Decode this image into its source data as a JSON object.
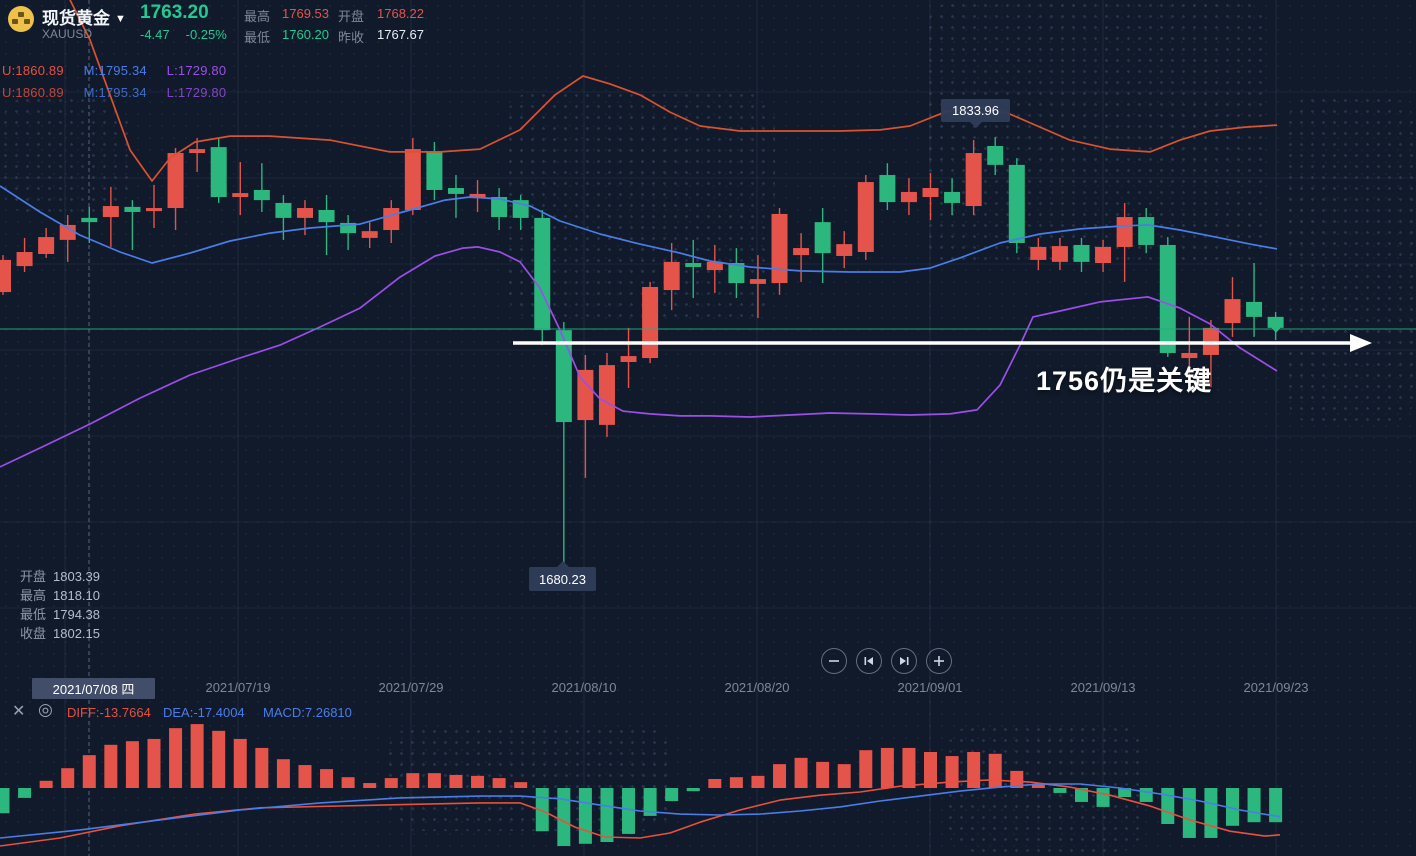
{
  "header": {
    "instrument": "现货黄金",
    "symbol": "XAUUSD",
    "price": "1763.20",
    "change": "-4.47",
    "change_pct": "-0.25%",
    "stats": [
      {
        "label": "最高",
        "value": "1769.53",
        "color": "red"
      },
      {
        "label": "开盘",
        "value": "1768.22",
        "color": "red"
      },
      {
        "label": "最低",
        "value": "1760.20",
        "color": "green"
      },
      {
        "label": "昨收",
        "value": "1767.67",
        "color": "white"
      }
    ]
  },
  "boll_rows": [
    {
      "u": "U:1860.89",
      "m": "M:1795.34",
      "l": "L:1729.80"
    },
    {
      "u": "U:1860.89",
      "m": "M:1795.34",
      "l": "L:1729.80"
    }
  ],
  "ohlc_panel": {
    "rows": [
      {
        "label": "开盘",
        "value": "1803.39"
      },
      {
        "label": "最高",
        "value": "1818.10"
      },
      {
        "label": "最低",
        "value": "1794.38"
      },
      {
        "label": "收盘",
        "value": "1802.15"
      }
    ]
  },
  "annotations": {
    "peak_label": "1833.96",
    "low_label": "1680.23",
    "key_level_text": "1756仍是关键"
  },
  "x_axis": {
    "highlighted": "2021/07/08 四",
    "ticks": [
      "2021/07/19",
      "2021/07/29",
      "2021/08/10",
      "2021/08/20",
      "2021/09/01",
      "2021/09/13",
      "2021/09/23"
    ]
  },
  "macd_bar": {
    "diff": "DIFF:-13.7664",
    "dea": "DEA:-17.4004",
    "macd": "MACD:7.26810"
  },
  "controls": [
    {
      "name": "zoom-out",
      "glyph": "minus"
    },
    {
      "name": "skip-to-start",
      "glyph": "bar-left-triangle"
    },
    {
      "name": "skip-to-end",
      "glyph": "triangle-bar-right"
    },
    {
      "name": "zoom-in",
      "glyph": "plus"
    }
  ],
  "colors": {
    "red": "#e4544b",
    "green": "#1fcb90",
    "white": "#e8edf5",
    "up": "#e4544b",
    "down": "#2bb77e",
    "band_upper": "#d9532f",
    "band_mid": "#4a7de8",
    "band_lower": "#9b4fe8",
    "dif": "#e8503f",
    "dea": "#4a7de8",
    "price_line": "#2aa87c",
    "accent_gold": "#eec24a"
  },
  "chart_data": {
    "type": "candlestick+macd",
    "symbol": "XAUUSD",
    "current_price": 1763.2,
    "legend": [
      "BOLL(upper)",
      "BOLL(mid)",
      "BOLL(lower)",
      "DIF",
      "DEA",
      "MACD"
    ],
    "candles": [
      [
        1776.3,
        1789.4,
        1775.3,
        1787.7
      ],
      [
        1785.5,
        1795.5,
        1783.4,
        1790.5
      ],
      [
        1789.8,
        1799.0,
        1788.4,
        1795.8
      ],
      [
        1794.8,
        1803.6,
        1787.0,
        1800.1
      ],
      [
        1802.6,
        1806.5,
        1793.7,
        1801.1
      ],
      [
        1802.9,
        1813.6,
        1792.3,
        1806.8
      ],
      [
        1806.5,
        1808.9,
        1791.2,
        1804.7
      ],
      [
        1805.0,
        1814.3,
        1799.0,
        1806.1
      ],
      [
        1806.1,
        1827.4,
        1798.3,
        1825.6
      ],
      [
        1825.6,
        1830.9,
        1818.9,
        1827.0
      ],
      [
        1827.7,
        1830.9,
        1807.9,
        1810.0
      ],
      [
        1810.0,
        1822.4,
        1803.6,
        1811.4
      ],
      [
        1812.5,
        1822.0,
        1804.7,
        1808.9
      ],
      [
        1807.9,
        1810.7,
        1794.8,
        1802.6
      ],
      [
        1802.6,
        1808.9,
        1796.5,
        1806.1
      ],
      [
        1805.4,
        1810.7,
        1789.4,
        1801.1
      ],
      [
        1800.8,
        1803.6,
        1791.2,
        1797.2
      ],
      [
        1795.5,
        1801.1,
        1791.9,
        1797.9
      ],
      [
        1798.3,
        1808.9,
        1793.7,
        1806.1
      ],
      [
        1805.4,
        1830.9,
        1803.6,
        1827.0
      ],
      [
        1826.0,
        1829.5,
        1808.9,
        1812.5
      ],
      [
        1813.2,
        1817.8,
        1802.6,
        1811.1
      ],
      [
        1809.6,
        1816.0,
        1804.7,
        1811.1
      ],
      [
        1810.0,
        1813.2,
        1798.3,
        1802.9
      ],
      [
        1808.9,
        1810.7,
        1798.3,
        1802.6
      ],
      [
        1802.6,
        1805.4,
        1757.5,
        1762.8
      ],
      [
        1762.8,
        1765.7,
        1680.2,
        1730.2
      ],
      [
        1730.9,
        1754.0,
        1710.4,
        1748.7
      ],
      [
        1729.2,
        1754.7,
        1724.9,
        1750.4
      ],
      [
        1751.5,
        1763.6,
        1742.3,
        1753.6
      ],
      [
        1752.9,
        1779.9,
        1751.1,
        1778.1
      ],
      [
        1777.0,
        1793.7,
        1769.9,
        1787.0
      ],
      [
        1786.6,
        1794.8,
        1774.2,
        1785.2
      ],
      [
        1784.1,
        1793.0,
        1776.0,
        1787.0
      ],
      [
        1786.6,
        1791.9,
        1774.2,
        1779.5
      ],
      [
        1779.2,
        1789.4,
        1767.1,
        1780.9
      ],
      [
        1779.5,
        1806.1,
        1775.3,
        1804.0
      ],
      [
        1789.4,
        1797.2,
        1779.9,
        1791.9
      ],
      [
        1801.1,
        1806.1,
        1779.5,
        1790.1
      ],
      [
        1789.1,
        1797.9,
        1784.8,
        1793.3
      ],
      [
        1790.5,
        1817.8,
        1787.7,
        1815.3
      ],
      [
        1817.8,
        1822.0,
        1805.4,
        1808.2
      ],
      [
        1808.2,
        1816.7,
        1803.6,
        1811.8
      ],
      [
        1810.0,
        1818.5,
        1801.8,
        1813.2
      ],
      [
        1811.8,
        1816.7,
        1803.6,
        1807.9
      ],
      [
        1806.8,
        1830.2,
        1803.6,
        1825.6
      ],
      [
        1828.1,
        1831.3,
        1817.8,
        1821.4
      ],
      [
        1821.4,
        1823.8,
        1790.1,
        1793.7
      ],
      [
        1787.7,
        1795.5,
        1784.1,
        1792.3
      ],
      [
        1787.0,
        1795.5,
        1784.1,
        1792.6
      ],
      [
        1793.0,
        1795.5,
        1783.4,
        1787.0
      ],
      [
        1786.6,
        1794.8,
        1783.4,
        1792.3
      ],
      [
        1792.3,
        1807.9,
        1779.9,
        1802.9
      ],
      [
        1802.9,
        1806.1,
        1790.1,
        1793.0
      ],
      [
        1793.0,
        1795.8,
        1753.3,
        1754.7
      ],
      [
        1752.9,
        1767.5,
        1742.6,
        1754.7
      ],
      [
        1754.0,
        1766.4,
        1742.6,
        1763.6
      ],
      [
        1765.3,
        1781.6,
        1760.4,
        1773.8
      ],
      [
        1772.8,
        1786.6,
        1760.4,
        1767.5
      ],
      [
        1767.5,
        1769.2,
        1759.3,
        1763.6
      ]
    ],
    "boll_upper": [
      [
        70,
        1879.9
      ],
      [
        90,
        1865.7
      ],
      [
        110,
        1846.2
      ],
      [
        130,
        1826.7
      ],
      [
        152,
        1815.7
      ],
      [
        170,
        1823.8
      ],
      [
        195,
        1829.5
      ],
      [
        230,
        1831.6
      ],
      [
        270,
        1831.6
      ],
      [
        330,
        1830.2
      ],
      [
        390,
        1826.0
      ],
      [
        440,
        1826.0
      ],
      [
        480,
        1827.0
      ],
      [
        520,
        1833.8
      ],
      [
        555,
        1846.2
      ],
      [
        583,
        1852.9
      ],
      [
        610,
        1850.1
      ],
      [
        640,
        1846.2
      ],
      [
        670,
        1840.1
      ],
      [
        700,
        1835.2
      ],
      [
        740,
        1833.4
      ],
      [
        790,
        1833.4
      ],
      [
        840,
        1833.4
      ],
      [
        880,
        1833.8
      ],
      [
        910,
        1835.2
      ],
      [
        945,
        1840.1
      ],
      [
        977,
        1842.3
      ],
      [
        1010,
        1839.4
      ],
      [
        1040,
        1834.8
      ],
      [
        1070,
        1830.2
      ],
      [
        1110,
        1827.0
      ],
      [
        1150,
        1826.0
      ],
      [
        1180,
        1830.2
      ],
      [
        1210,
        1833.4
      ],
      [
        1245,
        1834.8
      ],
      [
        1277,
        1835.5
      ]
    ],
    "boll_mid": [
      [
        0,
        1813.9
      ],
      [
        40,
        1804.7
      ],
      [
        80,
        1796.5
      ],
      [
        120,
        1790.5
      ],
      [
        152,
        1786.6
      ],
      [
        190,
        1790.1
      ],
      [
        230,
        1794.4
      ],
      [
        270,
        1797.2
      ],
      [
        310,
        1799.0
      ],
      [
        360,
        1800.4
      ],
      [
        410,
        1805.4
      ],
      [
        445,
        1808.9
      ],
      [
        470,
        1810.0
      ],
      [
        500,
        1809.3
      ],
      [
        530,
        1806.8
      ],
      [
        560,
        1801.5
      ],
      [
        600,
        1796.9
      ],
      [
        640,
        1793.3
      ],
      [
        680,
        1790.1
      ],
      [
        710,
        1787.3
      ],
      [
        750,
        1785.2
      ],
      [
        800,
        1783.8
      ],
      [
        850,
        1783.4
      ],
      [
        900,
        1783.4
      ],
      [
        930,
        1784.8
      ],
      [
        960,
        1788.4
      ],
      [
        1000,
        1793.7
      ],
      [
        1040,
        1796.9
      ],
      [
        1080,
        1798.7
      ],
      [
        1120,
        1799.7
      ],
      [
        1148,
        1800.1
      ],
      [
        1180,
        1798.3
      ],
      [
        1220,
        1795.5
      ],
      [
        1250,
        1793.3
      ],
      [
        1277,
        1791.6
      ]
    ],
    "boll_lower": [
      [
        0,
        1714.3
      ],
      [
        40,
        1721.0
      ],
      [
        90,
        1729.5
      ],
      [
        140,
        1738.7
      ],
      [
        190,
        1746.9
      ],
      [
        240,
        1752.9
      ],
      [
        280,
        1757.5
      ],
      [
        320,
        1763.9
      ],
      [
        360,
        1770.6
      ],
      [
        400,
        1781.6
      ],
      [
        435,
        1789.1
      ],
      [
        463,
        1791.9
      ],
      [
        478,
        1792.3
      ],
      [
        500,
        1790.5
      ],
      [
        520,
        1787.0
      ],
      [
        540,
        1777.7
      ],
      [
        560,
        1762.8
      ],
      [
        580,
        1746.2
      ],
      [
        600,
        1738.4
      ],
      [
        623,
        1734.1
      ],
      [
        650,
        1733.1
      ],
      [
        680,
        1732.4
      ],
      [
        710,
        1732.4
      ],
      [
        750,
        1732.0
      ],
      [
        790,
        1732.7
      ],
      [
        830,
        1733.4
      ],
      [
        870,
        1733.1
      ],
      [
        910,
        1732.7
      ],
      [
        950,
        1733.1
      ],
      [
        977,
        1734.5
      ],
      [
        1000,
        1743.3
      ],
      [
        1020,
        1757.5
      ],
      [
        1033,
        1767.5
      ],
      [
        1060,
        1769.6
      ],
      [
        1100,
        1772.8
      ],
      [
        1148,
        1774.6
      ],
      [
        1180,
        1770.6
      ],
      [
        1210,
        1765.0
      ],
      [
        1240,
        1756.5
      ],
      [
        1277,
        1748.3
      ]
    ],
    "macd_hist": [
      -5.6,
      -2.2,
      1.6,
      4.4,
      7.3,
      9.6,
      10.4,
      10.9,
      13.3,
      14.2,
      12.7,
      10.9,
      8.9,
      6.4,
      5.1,
      4.2,
      2.4,
      1.1,
      2.2,
      3.3,
      3.3,
      2.9,
      2.7,
      2.2,
      1.3,
      -9.6,
      -12.9,
      -12.4,
      -12.0,
      -10.2,
      -6.2,
      -2.9,
      -0.7,
      2.0,
      2.4,
      2.7,
      5.3,
      6.7,
      5.8,
      5.3,
      8.4,
      8.9,
      8.9,
      8.0,
      7.1,
      8.0,
      7.6,
      3.8,
      0.9,
      -1.1,
      -3.1,
      -4.2,
      -2.0,
      -3.1,
      -8.0,
      -11.1,
      -11.1,
      -8.4,
      -7.6,
      -7.6
    ],
    "dif_line": [
      [
        0,
        -12.9
      ],
      [
        60,
        -11.1
      ],
      [
        120,
        -8.4
      ],
      [
        195,
        -5.8
      ],
      [
        260,
        -4.4
      ],
      [
        340,
        -4.0
      ],
      [
        420,
        -3.6
      ],
      [
        480,
        -3.3
      ],
      [
        520,
        -3.3
      ],
      [
        545,
        -5.3
      ],
      [
        575,
        -8.7
      ],
      [
        605,
        -10.9
      ],
      [
        640,
        -11.1
      ],
      [
        670,
        -10.0
      ],
      [
        700,
        -7.6
      ],
      [
        740,
        -4.9
      ],
      [
        780,
        -2.7
      ],
      [
        820,
        -1.6
      ],
      [
        860,
        -0.9
      ],
      [
        900,
        0.4
      ],
      [
        950,
        1.3
      ],
      [
        990,
        1.8
      ],
      [
        1030,
        1.3
      ],
      [
        1070,
        0.2
      ],
      [
        1110,
        -1.6
      ],
      [
        1150,
        -4.0
      ],
      [
        1190,
        -7.1
      ],
      [
        1230,
        -9.6
      ],
      [
        1265,
        -10.7
      ],
      [
        1280,
        -10.4
      ]
    ],
    "dea_line": [
      [
        0,
        -11.1
      ],
      [
        80,
        -9.3
      ],
      [
        160,
        -7.1
      ],
      [
        240,
        -4.9
      ],
      [
        320,
        -3.3
      ],
      [
        400,
        -2.2
      ],
      [
        480,
        -1.8
      ],
      [
        520,
        -1.8
      ],
      [
        560,
        -2.4
      ],
      [
        600,
        -3.8
      ],
      [
        640,
        -5.1
      ],
      [
        680,
        -5.8
      ],
      [
        720,
        -6.0
      ],
      [
        760,
        -5.8
      ],
      [
        800,
        -5.1
      ],
      [
        840,
        -4.2
      ],
      [
        880,
        -2.9
      ],
      [
        920,
        -1.8
      ],
      [
        960,
        -0.7
      ],
      [
        1000,
        0.2
      ],
      [
        1040,
        0.9
      ],
      [
        1080,
        0.9
      ],
      [
        1120,
        0.0
      ],
      [
        1160,
        -1.3
      ],
      [
        1200,
        -2.9
      ],
      [
        1240,
        -4.9
      ],
      [
        1280,
        -6.4
      ]
    ]
  }
}
